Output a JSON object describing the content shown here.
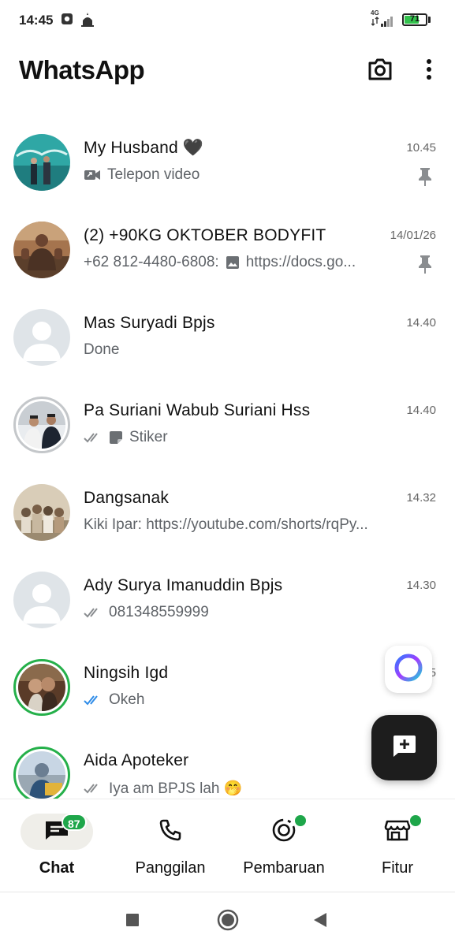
{
  "status_bar": {
    "time": "14:45",
    "network": "4G",
    "battery_level": "71",
    "battery_fraction": 0.71
  },
  "header": {
    "title": "WhatsApp",
    "camera_icon": "camera-icon",
    "menu_icon": "more-vert-icon"
  },
  "chats": [
    {
      "name": "My Husband 🖤",
      "time": "10.45",
      "preview": "Telepon video",
      "preview_icon": "video-call-icon",
      "pinned": true,
      "avatar_style": "teal-photo"
    },
    {
      "name": "(2) +90KG OKTOBER BODYFIT",
      "time": "14/01/26",
      "preview_sender": "+62 812-4480-6808:",
      "preview": "https://docs.go...",
      "preview_icon": "image-icon",
      "pinned": true,
      "avatar_style": "brown-photo"
    },
    {
      "name": "Mas Suryadi Bpjs",
      "time": "14.40",
      "preview": "Done",
      "avatar_style": "default"
    },
    {
      "name": "Pa Suriani Wabub Suriani Hss",
      "time": "14.40",
      "preview": "Stiker",
      "preview_icon": "sticker-icon",
      "ticks": "gray",
      "avatar_style": "ring-gray-photo"
    },
    {
      "name": "Dangsanak",
      "time": "14.32",
      "preview": "Kiki Ipar: https://youtube.com/shorts/rqPy...",
      "avatar_style": "group-photo"
    },
    {
      "name": "Ady Surya Imanuddin Bpjs",
      "time": "14.30",
      "preview": "081348559999",
      "ticks": "gray",
      "avatar_style": "default"
    },
    {
      "name": "Ningsih Igd",
      "time": "5",
      "preview": "Okeh",
      "ticks": "blue",
      "avatar_style": "ring-green-photo"
    },
    {
      "name": "Aida Apoteker",
      "time": "",
      "preview": "Iya am BPJS lah 🤭",
      "ticks": "gray",
      "avatar_style": "ring-green-photo2"
    }
  ],
  "bottom_nav": [
    {
      "label": "Chat",
      "icon": "chat-icon",
      "badge": "87",
      "active": true
    },
    {
      "label": "Panggilan",
      "icon": "phone-icon"
    },
    {
      "label": "Pembaruan",
      "icon": "status-icon",
      "dot": true
    },
    {
      "label": "Fitur",
      "icon": "store-icon",
      "dot": true
    }
  ],
  "colors": {
    "accent_green": "#1ea64a",
    "read_ticks_blue": "#2f8ce8",
    "text_secondary": "#5f6368"
  }
}
